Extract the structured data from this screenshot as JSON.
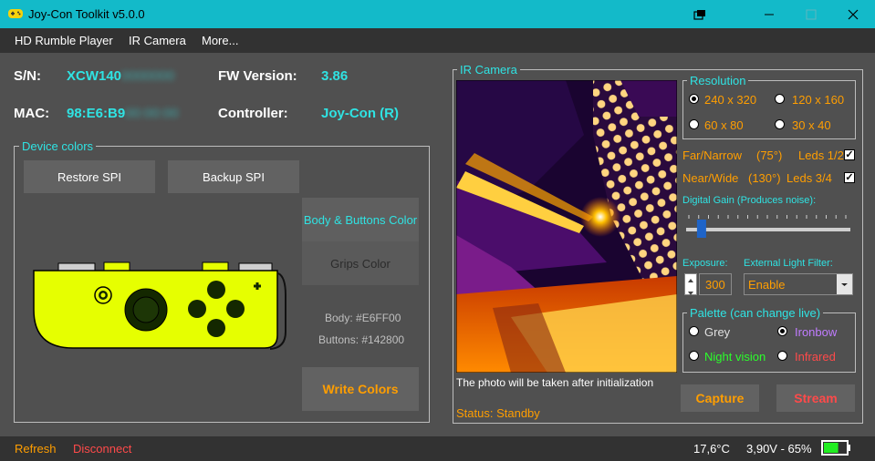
{
  "window": {
    "title": "Joy-Con Toolkit v5.0.0"
  },
  "menu": [
    "HD Rumble Player",
    "IR Camera",
    "More..."
  ],
  "info": {
    "sn_label": "S/N:",
    "sn_value": "XCW140",
    "sn_blur": "0000000",
    "fw_label": "FW Version:",
    "fw_value": "3.86",
    "mac_label": "MAC:",
    "mac_value": "98:E6:B9",
    "mac_blur": "00:00:00",
    "controller_label": "Controller:",
    "controller_value": "Joy-Con (R)"
  },
  "device_colors": {
    "legend": "Device colors",
    "restore_label": "Restore SPI",
    "backup_label": "Backup SPI",
    "body_buttons_label": "Body & Buttons Color",
    "grips_label": "Grips Color",
    "body_text": "Body: #E6FF00",
    "buttons_text": "Buttons: #142800",
    "write_label": "Write Colors",
    "body_color": "#E6FF00",
    "buttons_color": "#142800"
  },
  "ir_camera": {
    "legend": "IR Camera",
    "photo_note": "The photo will be taken after initialization",
    "status": "Status: Standby"
  },
  "resolution": {
    "legend": "Resolution",
    "options": [
      "240 x 320",
      "120 x 160",
      "60 x 80",
      "30 x 40"
    ],
    "selected": "240 x 320"
  },
  "leds": {
    "far_label": "Far/Narrow",
    "far_angle": "(75°)",
    "far_leds": "Leds 1/2",
    "near_label": "Near/Wide",
    "near_angle": "(130°)",
    "near_leds": "Leds 3/4",
    "check_mark": "✓"
  },
  "gain": {
    "label": "Digital Gain (Produces noise):",
    "level": 0.07
  },
  "exposure": {
    "label": "Exposure:",
    "value": "300"
  },
  "filter": {
    "label": "External Light Filter:",
    "value": "Enable"
  },
  "palette": {
    "legend": "Palette (can change live)",
    "grey": "Grey",
    "ironbow": "Ironbow",
    "night": "Night vision",
    "infrared": "Infrared",
    "selected": "Ironbow"
  },
  "actions": {
    "capture_label": "Capture",
    "stream_label": "Stream"
  },
  "status_bar": {
    "refresh_label": "Refresh",
    "disconnect_label": "Disconnect",
    "temperature": "17,6°C",
    "battery": "3,90V - 65%",
    "battery_level": 0.65
  },
  "colors": {
    "accent": "#13bac9",
    "cyan": "#2fe3e3",
    "orange": "#ff9e00",
    "red": "#ff4a4a",
    "green": "#2bff2b",
    "battery": "#22ee22"
  }
}
